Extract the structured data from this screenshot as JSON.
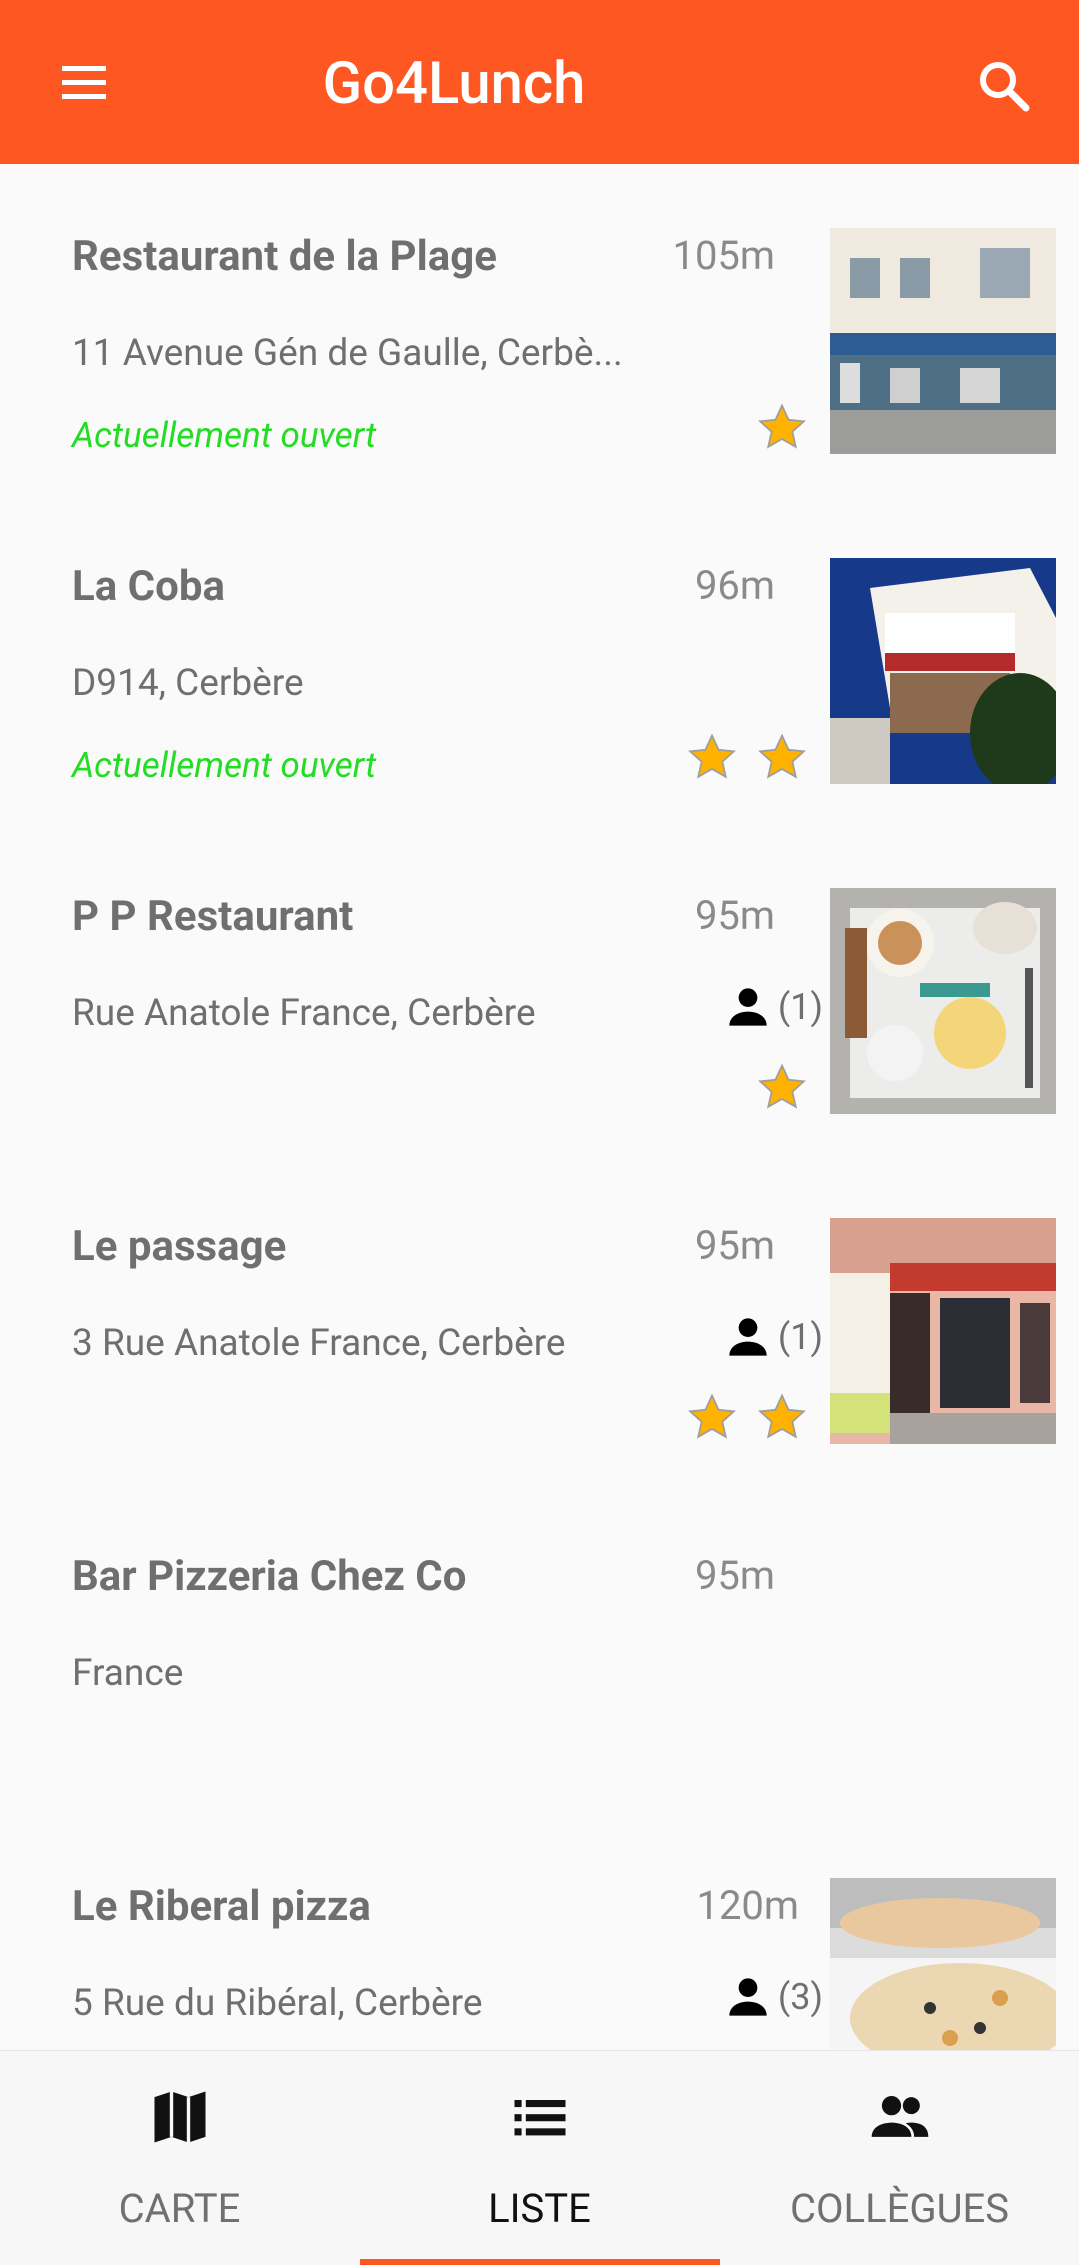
{
  "app_bar": {
    "title": "Go4Lunch",
    "menu_icon": "menu-icon",
    "search_icon": "search-icon",
    "background": "#ff5722"
  },
  "restaurants": [
    {
      "name": "Restaurant de la Plage",
      "distance": "105m",
      "address": "11 Avenue Gén de Gaulle, Cerbè...",
      "status": "Actuellement ouvert",
      "rating": 1,
      "workmates": ""
    },
    {
      "name": "La Coba",
      "distance": "96m",
      "address": "D914, Cerbère",
      "status": "Actuellement ouvert",
      "rating": 2,
      "workmates": ""
    },
    {
      "name": "P P Restaurant",
      "distance": "95m",
      "address": "Rue Anatole France, Cerbère",
      "status": "",
      "rating": 1,
      "workmates": "(1)"
    },
    {
      "name": "Le passage",
      "distance": "95m",
      "address": "3 Rue Anatole France, Cerbère",
      "status": "",
      "rating": 2,
      "workmates": "(1)"
    },
    {
      "name": "Bar Pizzeria Chez Co",
      "distance": "95m",
      "address": "France",
      "status": "",
      "rating": 0,
      "workmates": ""
    },
    {
      "name": "Le Riberal pizza",
      "distance": "120m",
      "address": "5 Rue du Ribéral, Cerbère",
      "status": "",
      "rating": 0,
      "workmates": "(3)"
    }
  ],
  "bottom_nav": {
    "tabs": [
      {
        "label": "CARTE",
        "icon": "map-icon"
      },
      {
        "label": "LISTE",
        "icon": "list-icon",
        "active": true
      },
      {
        "label": "COLLÈGUES",
        "icon": "people-icon"
      }
    ]
  },
  "colors": {
    "accent": "#ff5722",
    "open_status": "#22dd22",
    "star": "#ffb300"
  }
}
